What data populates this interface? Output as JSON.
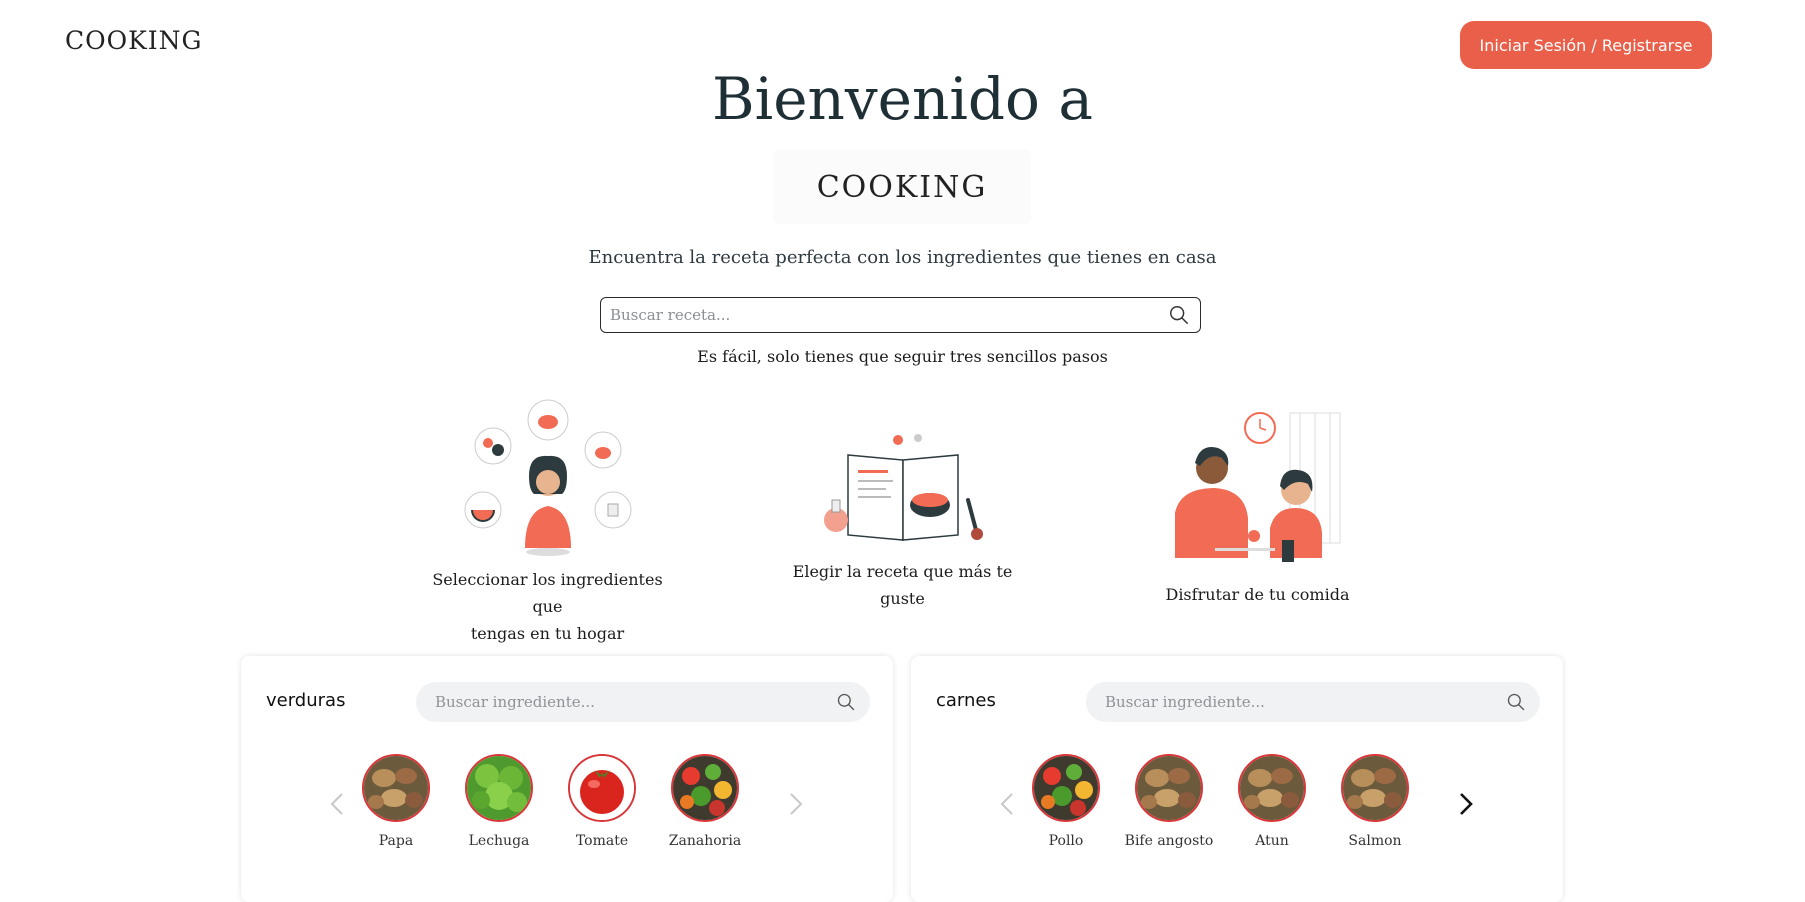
{
  "header": {
    "logo_text": "COOKING",
    "login_button": "Iniciar Sesión / Registrarse"
  },
  "hero": {
    "title": "Bienvenido a",
    "logo_text": "COOKING",
    "subtitle": "Encuentra la receta perfecta con los ingredientes que tienes en casa",
    "search_placeholder": "Buscar receta...",
    "steps_note": "Es fácil, solo tienes que seguir tres sencillos pasos"
  },
  "steps": [
    {
      "label_line1": "Seleccionar los ingredientes que",
      "label_line2": "tengas en tu hogar",
      "illustration": "person-with-ingredients"
    },
    {
      "label": "Elegir la receta que más te guste",
      "illustration": "recipe-book"
    },
    {
      "label": "Disfrutar de tu comida",
      "illustration": "people-eating"
    }
  ],
  "panels": [
    {
      "title": "verduras",
      "search_placeholder": "Buscar ingrediente...",
      "items": [
        {
          "name": "Papa",
          "image": "potatoes"
        },
        {
          "name": "Lechuga",
          "image": "lettuce"
        },
        {
          "name": "Tomate",
          "image": "tomato"
        },
        {
          "name": "Zanahoria",
          "image": "vegetables"
        }
      ],
      "prev_enabled": false,
      "next_enabled": false
    },
    {
      "title": "carnes",
      "search_placeholder": "Buscar ingrediente...",
      "items": [
        {
          "name": "Pollo",
          "image": "vegetables"
        },
        {
          "name": "Bife angosto",
          "image": "potatoes"
        },
        {
          "name": "Atun",
          "image": "potatoes"
        },
        {
          "name": "Salmon",
          "image": "potatoes"
        }
      ],
      "prev_enabled": false,
      "next_enabled": true
    }
  ],
  "colors": {
    "accent": "#ea5f4a",
    "illustration_accent": "#f26b54",
    "ingredient_border": "#d9363a",
    "text_dark": "#1f2d33"
  }
}
